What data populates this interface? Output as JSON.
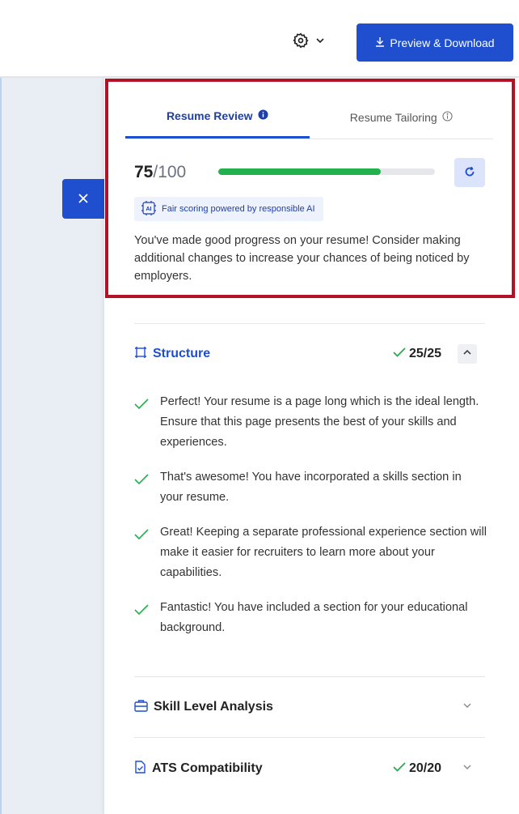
{
  "header": {
    "preview_label": "Preview & Download"
  },
  "review": {
    "tabs": [
      {
        "label": "Resume Review"
      },
      {
        "label": "Resume Tailoring"
      }
    ],
    "score": "75",
    "score_total": "/100",
    "progress_percent": 75,
    "ai_badge": "Fair scoring powered by responsible AI",
    "summary": "You've made good progress on your resume! Consider making additional changes to increase your chances of being noticed by employers."
  },
  "sections": [
    {
      "title": "Structure",
      "score": "25/25",
      "expanded": true,
      "checks": [
        "Perfect! Your resume is a page long which is the ideal length. Ensure that this page presents the best of your skills and experiences.",
        "That's awesome! You have incorporated a skills section in your resume.",
        "Great! Keeping a separate professional experience section will make it easier for recruiters to learn more about your capabilities.",
        "Fantastic! You have included a section for your educational background."
      ]
    },
    {
      "title": "Skill Level Analysis",
      "score": "",
      "expanded": false
    },
    {
      "title": "ATS Compatibility",
      "score": "20/20",
      "expanded": false
    }
  ],
  "colors": {
    "primary": "#1f4ecf",
    "success": "#22b14c",
    "highlight_border": "#b11226"
  }
}
